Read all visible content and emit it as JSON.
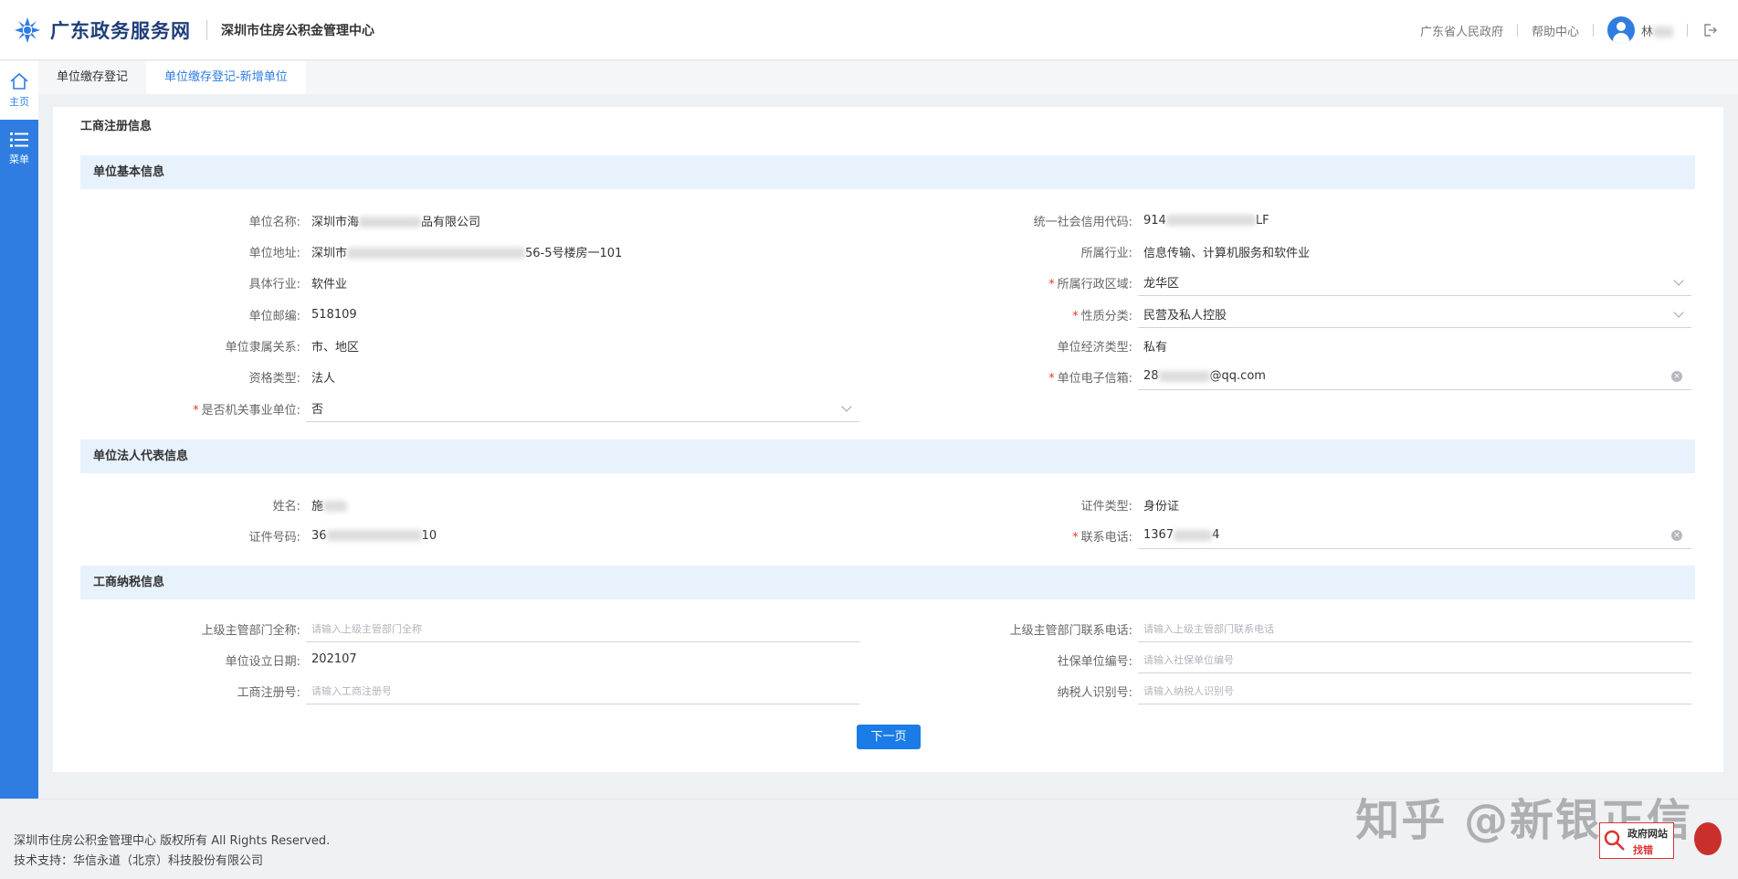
{
  "header": {
    "site_title": "广东政务服务网",
    "org_name": "深圳市住房公积金管理中心",
    "link_gov": "广东省人民政府",
    "link_help": "帮助中心",
    "user_name": "林"
  },
  "sidebar": {
    "home_label": "主页",
    "menu_label": "菜单"
  },
  "tabs": [
    {
      "label": "单位缴存登记"
    },
    {
      "label": "单位缴存登记-新增单位"
    }
  ],
  "card_title": "工商注册信息",
  "sections": {
    "basic": "单位基本信息",
    "legal": "单位法人代表信息",
    "tax": "工商纳税信息"
  },
  "basic": {
    "name_label": "单位名称:",
    "name_prefix": "深圳市海",
    "name_suffix": "品有限公司",
    "credit_label": "统一社会信用代码:",
    "credit_prefix": "914",
    "credit_suffix": "LF",
    "address_label": "单位地址:",
    "address_prefix": "深圳市",
    "address_suffix": "56-5号楼房一101",
    "industry_label": "所属行业:",
    "industry_value": "信息传输、计算机服务和软件业",
    "spec_industry_label": "具体行业:",
    "spec_industry_value": "软件业",
    "district_label": "所属行政区域:",
    "district_value": "龙华区",
    "postcode_label": "单位邮编:",
    "postcode_value": "518109",
    "nature_label": "性质分类:",
    "nature_value": "民营及私人控股",
    "affiliation_label": "单位隶属关系:",
    "affiliation_value": "市、地区",
    "econ_type_label": "单位经济类型:",
    "econ_type_value": "私有",
    "qual_type_label": "资格类型:",
    "qual_type_value": "法人",
    "email_label": "单位电子信箱:",
    "email_prefix": "28",
    "email_suffix": "@qq.com",
    "gov_unit_label": "是否机关事业单位:",
    "gov_unit_value": "否"
  },
  "legal": {
    "name_label": "姓名:",
    "name_prefix": "施",
    "id_type_label": "证件类型:",
    "id_type_value": "身份证",
    "id_no_label": "证件号码:",
    "id_no_prefix": "36",
    "id_no_suffix": "10",
    "phone_label": "联系电话:",
    "phone_prefix": "1367",
    "phone_suffix": "4"
  },
  "tax": {
    "parent_dept_label": "上级主管部门全称:",
    "parent_dept_placeholder": "请输入上级主管部门全称",
    "parent_phone_label": "上级主管部门联系电话:",
    "parent_phone_placeholder": "请输入上级主管部门联系电话",
    "setup_date_label": "单位设立日期:",
    "setup_date_value": "202107",
    "social_no_label": "社保单位编号:",
    "social_no_placeholder": "请输入社保单位编号",
    "reg_no_label": "工商注册号:",
    "reg_no_placeholder": "请输入工商注册号",
    "taxpayer_label": "纳税人识别号:",
    "taxpayer_placeholder": "请输入纳税人识别号"
  },
  "next_button": "下一页",
  "footer": {
    "copyright": "深圳市住房公积金管理中心  版权所有 All Rights Reserved.",
    "support": "技术支持：华信永道（北京）科技股份有限公司",
    "watermark": "知乎 @新银正信",
    "badge_line1": "政府网站",
    "badge_line2": "找错"
  },
  "colors": {
    "primary": "#2f7de1",
    "section_bg": "#e8f2fc",
    "required": "#e53935"
  }
}
